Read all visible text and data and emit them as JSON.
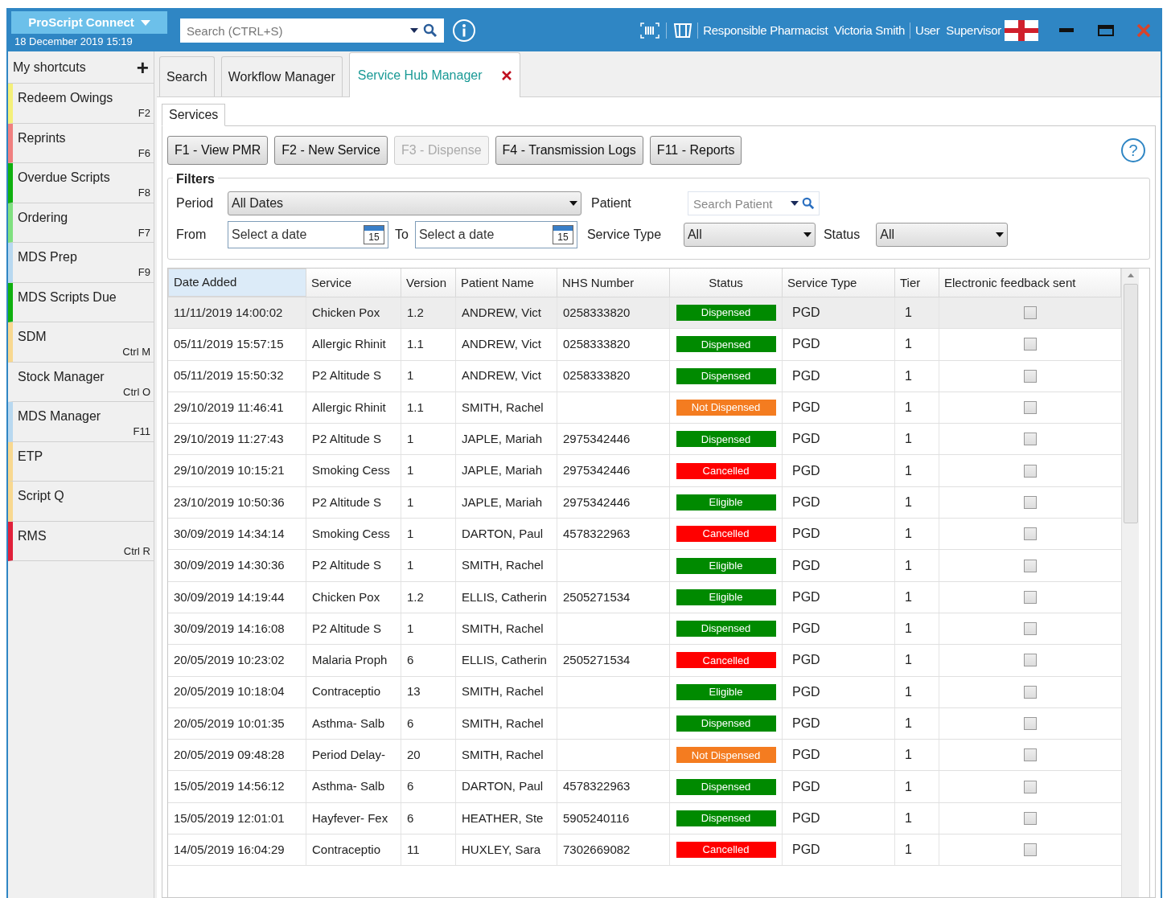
{
  "app": {
    "title": "ProScript Connect",
    "datetime": "18 December 2019 15:19",
    "search": {
      "placeholder": "Search (CTRL+S)"
    },
    "pharmacist": "Responsible Pharmacist  Victoria Smith",
    "user": "User  Supervisor"
  },
  "shortcuts": {
    "title": "My shortcuts",
    "add": "+",
    "items": [
      {
        "label": "Redeem Owings",
        "key": "F2",
        "color": "#f4f07a"
      },
      {
        "label": "Reprints",
        "key": "F6",
        "color": "#f08080"
      },
      {
        "label": "Overdue Scripts",
        "key": "F8",
        "color": "#10b010"
      },
      {
        "label": "Ordering",
        "key": "F7",
        "color": "#80e080"
      },
      {
        "label": "MDS Prep",
        "key": "F9",
        "color": "#b8d8f0"
      },
      {
        "label": "MDS Scripts Due",
        "color": "#10b010"
      },
      {
        "label": "SDM",
        "key": "Ctrl M",
        "color": "#f8d890"
      },
      {
        "label": "Stock Manager",
        "key": "Ctrl O",
        "color": "#f0f0f0"
      },
      {
        "label": "MDS Manager",
        "key": "F11",
        "color": "#b8d8f0"
      },
      {
        "label": "ETP",
        "color": "#f8d890"
      },
      {
        "label": "Script Q",
        "color": "#f8d890"
      },
      {
        "label": "RMS",
        "key": "Ctrl R",
        "color": "#e0203a"
      }
    ]
  },
  "tabs": [
    {
      "label": "Search",
      "selected": false
    },
    {
      "label": "Workflow Manager",
      "selected": false
    },
    {
      "label": "Service Hub Manager",
      "selected": true,
      "closable": true
    }
  ],
  "subtabs": [
    {
      "label": "Services",
      "selected": true
    }
  ],
  "toolbar": [
    {
      "label": "F1 - View PMR",
      "disabled": false
    },
    {
      "label": "F2 - New Service",
      "disabled": false
    },
    {
      "label": "F3 - Dispense",
      "disabled": true
    },
    {
      "label": "F4 - Transmission Logs",
      "disabled": false
    },
    {
      "label": "F11 - Reports",
      "disabled": false
    }
  ],
  "filters": {
    "title": "Filters",
    "period_label": "Period",
    "period": "All Dates",
    "from_label": "From",
    "from_placeholder": "Select a date",
    "to_label": "To",
    "to_placeholder": "Select a date",
    "patient_label": "Patient",
    "patient_placeholder": "Search Patient",
    "service_type_label": "Service Type",
    "service_type": "All",
    "status_label": "Status",
    "status": "All",
    "from_calendar_day": "15",
    "to_calendar_day": "15"
  },
  "help": "?",
  "table": {
    "columns": [
      "Date Added",
      "Service",
      "Version",
      "Patient Name",
      "NHS Number",
      "Status",
      "Service Type",
      "Tier",
      "Electronic feedback sent"
    ],
    "rows": [
      {
        "date": "11/11/2019 14:00:02",
        "service": "Chicken Pox",
        "version": "1.2",
        "patient": "ANDREW, Vict",
        "nhs": "0258333820",
        "status": "Dispensed",
        "color": "#008a00",
        "type": "PGD",
        "tier": "1",
        "feedback": false,
        "selected": true
      },
      {
        "date": "05/11/2019 15:57:15",
        "service": "Allergic Rhinit",
        "version": "1.1",
        "patient": "ANDREW, Vict",
        "nhs": "0258333820",
        "status": "Dispensed",
        "color": "#008a00",
        "type": "PGD",
        "tier": "1",
        "feedback": false,
        "selected": false
      },
      {
        "date": "05/11/2019 15:50:32",
        "service": "P2 Altitude S",
        "version": "1",
        "patient": "ANDREW, Vict",
        "nhs": "0258333820",
        "status": "Dispensed",
        "color": "#008a00",
        "type": "PGD",
        "tier": "1",
        "feedback": false,
        "selected": false
      },
      {
        "date": "29/10/2019 11:46:41",
        "service": "Allergic Rhinit",
        "version": "1.1",
        "patient": "SMITH, Rachel",
        "status": "Not Dispensed",
        "color": "#f47c20",
        "type": "PGD",
        "tier": "1",
        "feedback": false,
        "selected": false
      },
      {
        "date": "29/10/2019 11:27:43",
        "service": "P2 Altitude S",
        "version": "1",
        "patient": "JAPLE, Mariah",
        "nhs": "2975342446",
        "status": "Dispensed",
        "color": "#008a00",
        "type": "PGD",
        "tier": "1",
        "feedback": false,
        "selected": false
      },
      {
        "date": "29/10/2019 10:15:21",
        "service": "Smoking Cess",
        "version": "1",
        "patient": "JAPLE, Mariah",
        "nhs": "2975342446",
        "status": "Cancelled",
        "color": "#ff0000",
        "type": "PGD",
        "tier": "1",
        "feedback": false,
        "selected": false
      },
      {
        "date": "23/10/2019 10:50:36",
        "service": "P2 Altitude S",
        "version": "1",
        "patient": "JAPLE, Mariah",
        "nhs": "2975342446",
        "status": "Eligible",
        "color": "#008a00",
        "type": "PGD",
        "tier": "1",
        "feedback": false,
        "selected": false
      },
      {
        "date": "30/09/2019 14:34:14",
        "service": "Smoking Cess",
        "version": "1",
        "patient": "DARTON, Paul",
        "nhs": "4578322963",
        "status": "Cancelled",
        "color": "#ff0000",
        "type": "PGD",
        "tier": "1",
        "feedback": false,
        "selected": false
      },
      {
        "date": "30/09/2019 14:30:36",
        "service": "P2 Altitude S",
        "version": "1",
        "patient": "SMITH, Rachel",
        "status": "Eligible",
        "color": "#008a00",
        "type": "PGD",
        "tier": "1",
        "feedback": false,
        "selected": false
      },
      {
        "date": "30/09/2019 14:19:44",
        "service": "Chicken Pox",
        "version": "1.2",
        "patient": "ELLIS, Catherin",
        "nhs": "2505271534",
        "status": "Eligible",
        "color": "#008a00",
        "type": "PGD",
        "tier": "1",
        "feedback": false,
        "selected": false
      },
      {
        "date": "30/09/2019 14:16:08",
        "service": "P2 Altitude S",
        "version": "1",
        "patient": "SMITH, Rachel",
        "status": "Dispensed",
        "color": "#008a00",
        "type": "PGD",
        "tier": "1",
        "feedback": false,
        "selected": false
      },
      {
        "date": "20/05/2019 10:23:02",
        "service": "Malaria Proph",
        "version": "6",
        "patient": "ELLIS, Catherin",
        "nhs": "2505271534",
        "status": "Cancelled",
        "color": "#ff0000",
        "type": "PGD",
        "tier": "1",
        "feedback": false,
        "selected": false
      },
      {
        "date": "20/05/2019 10:18:04",
        "service": "Contraceptio",
        "version": "13",
        "patient": "SMITH, Rachel",
        "status": "Eligible",
        "color": "#008a00",
        "type": "PGD",
        "tier": "1",
        "feedback": false,
        "selected": false
      },
      {
        "date": "20/05/2019 10:01:35",
        "service": "Asthma- Salb",
        "version": "6",
        "patient": "SMITH, Rachel",
        "status": "Dispensed",
        "color": "#008a00",
        "type": "PGD",
        "tier": "1",
        "feedback": false,
        "selected": false
      },
      {
        "date": "20/05/2019 09:48:28",
        "service": "Period Delay-",
        "version": "20",
        "patient": "SMITH, Rachel",
        "status": "Not Dispensed",
        "color": "#f47c20",
        "type": "PGD",
        "tier": "1",
        "feedback": false,
        "selected": false
      },
      {
        "date": "15/05/2019 14:56:12",
        "service": "Asthma- Salb",
        "version": "6",
        "patient": "DARTON, Paul",
        "nhs": "4578322963",
        "status": "Dispensed",
        "color": "#008a00",
        "type": "PGD",
        "tier": "1",
        "feedback": false,
        "selected": false
      },
      {
        "date": "15/05/2019 12:01:01",
        "service": "Hayfever- Fex",
        "version": "6",
        "patient": "HEATHER, Ste",
        "nhs": "5905240116",
        "status": "Dispensed",
        "color": "#008a00",
        "type": "PGD",
        "tier": "1",
        "feedback": false,
        "selected": false
      },
      {
        "date": "14/05/2019 16:04:29",
        "service": "Contraceptio",
        "version": "11",
        "patient": "HUXLEY, Sara",
        "nhs": "7302669082",
        "status": "Cancelled",
        "color": "#ff0000",
        "type": "PGD",
        "tier": "1",
        "feedback": false,
        "selected": false
      }
    ]
  }
}
